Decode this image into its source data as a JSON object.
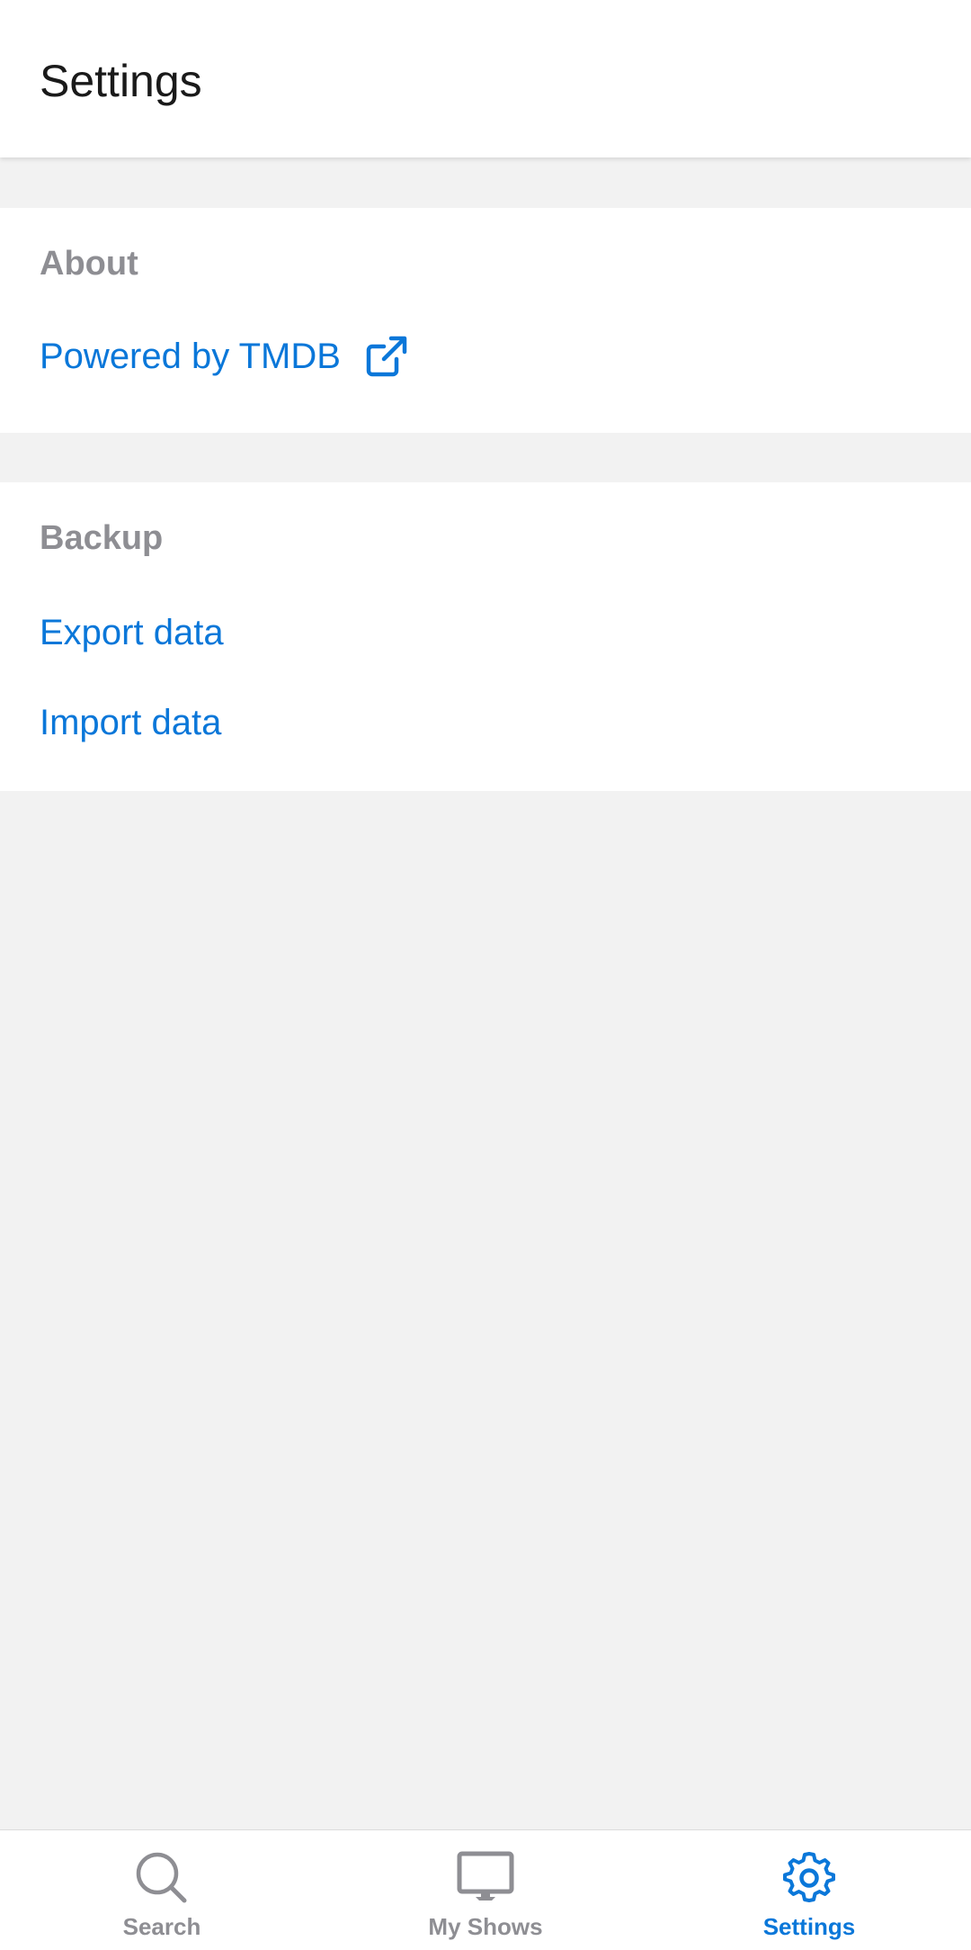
{
  "header": {
    "title": "Settings"
  },
  "sections": {
    "about": {
      "title": "About",
      "tmdb_link": "Powered by TMDB"
    },
    "backup": {
      "title": "Backup",
      "export_link": "Export data",
      "import_link": "Import data"
    }
  },
  "tabbar": {
    "tabs": [
      {
        "label": "Search",
        "icon": "search-icon",
        "active": false
      },
      {
        "label": "My Shows",
        "icon": "tv-icon",
        "active": false
      },
      {
        "label": "Settings",
        "icon": "gear-icon",
        "active": true
      }
    ]
  },
  "colors": {
    "accent": "#0a77d9",
    "inactive": "#8e8e93",
    "background": "#f2f2f2"
  }
}
